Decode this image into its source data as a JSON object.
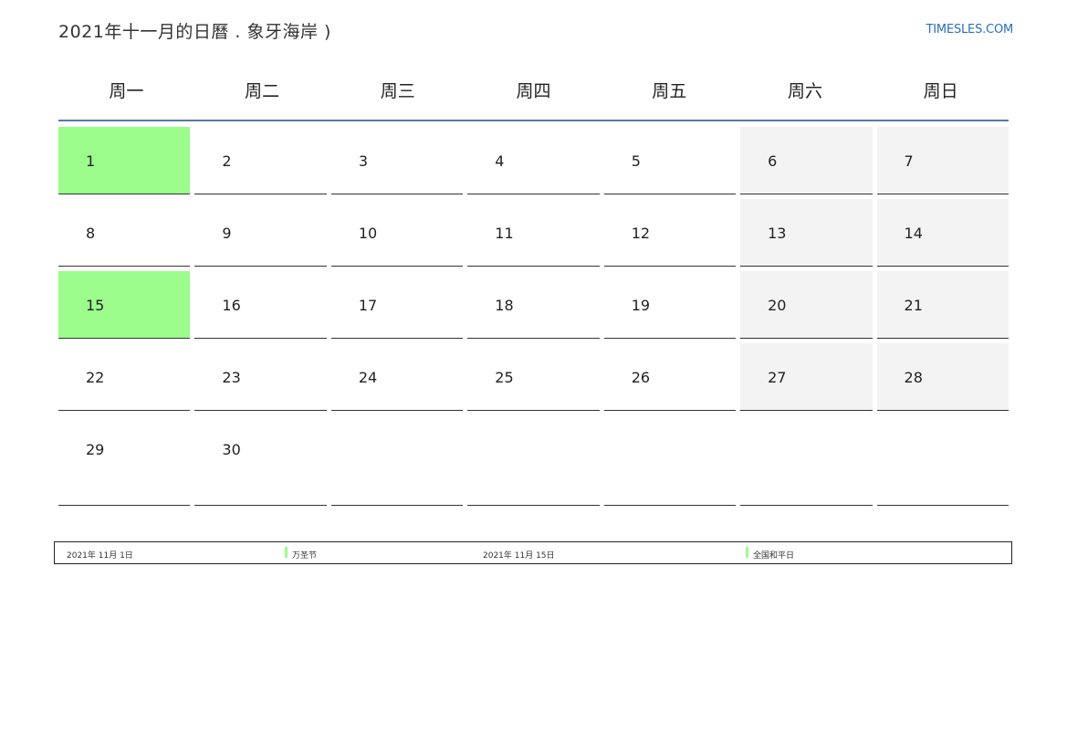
{
  "header": {
    "title": "2021年十一月的日曆 . 象牙海岸 )",
    "site": "TIMESLES.COM"
  },
  "weekdays": [
    "周一",
    "周二",
    "周三",
    "周四",
    "周五",
    "周六",
    "周日"
  ],
  "weeks": [
    [
      "1",
      "2",
      "3",
      "4",
      "5",
      "6",
      "7"
    ],
    [
      "8",
      "9",
      "10",
      "11",
      "12",
      "13",
      "14"
    ],
    [
      "15",
      "16",
      "17",
      "18",
      "19",
      "20",
      "21"
    ],
    [
      "22",
      "23",
      "24",
      "25",
      "26",
      "27",
      "28"
    ],
    [
      "29",
      "30",
      "",
      "",
      "",
      "",
      ""
    ]
  ],
  "holidays": [
    {
      "date": "2021年 11月 1日",
      "name": "万圣节"
    },
    {
      "date": "2021年 11月 15日",
      "name": "全国和平日"
    }
  ],
  "colors": {
    "holiday": "#9cfc8c",
    "weekend": "#f3f3f3",
    "header_rule": "#5b7aa3",
    "site_link": "#2a6fba"
  }
}
